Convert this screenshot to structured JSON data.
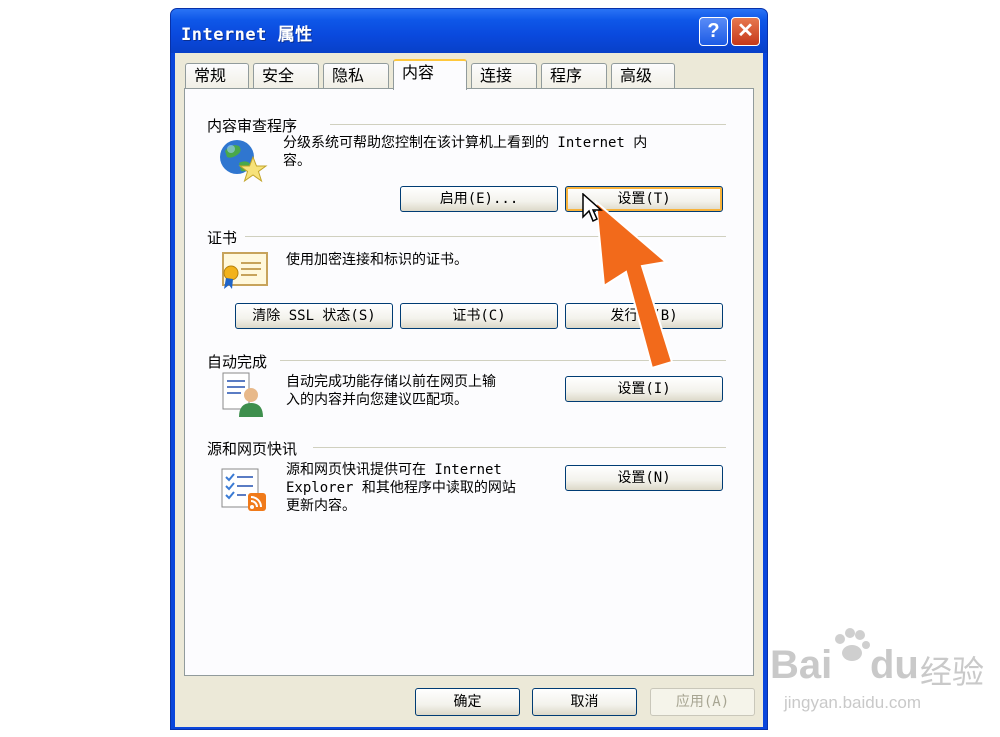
{
  "window": {
    "title": "Internet 属性",
    "help_symbol": "?",
    "close_symbol": "✕"
  },
  "tabs": [
    {
      "label": "常规"
    },
    {
      "label": "安全"
    },
    {
      "label": "隐私"
    },
    {
      "label": "内容"
    },
    {
      "label": "连接"
    },
    {
      "label": "程序"
    },
    {
      "label": "高级"
    }
  ],
  "active_tab": "内容",
  "content_advisor": {
    "title": "内容审查程序",
    "desc_line1": "分级系统可帮助您控制在该计算机上看到的 Internet 内",
    "desc_line2": "容。",
    "enable_label": "启用(E)...",
    "settings_label": "设置(T)"
  },
  "certificates": {
    "title": "证书",
    "desc": "使用加密连接和标识的证书。",
    "clear_ssl_label": "清除 SSL 状态(S)",
    "certs_label": "证书(C)",
    "publishers_label": "发行者(B)"
  },
  "autocomplete": {
    "title": "自动完成",
    "desc_line1": "自动完成功能存储以前在网页上输",
    "desc_line2": "入的内容并向您建议匹配项。",
    "settings_label": "设置(I)"
  },
  "feeds": {
    "title": "源和网页快讯",
    "desc_line1": "源和网页快讯提供可在 Internet",
    "desc_line2": "Explorer 和其他程序中读取的网站",
    "desc_line3": "更新内容。",
    "settings_label": "设置(N)"
  },
  "footer": {
    "ok_label": "确定",
    "cancel_label": "取消",
    "apply_label": "应用(A)"
  },
  "annotation": {
    "arrow_color": "#f26a1b"
  },
  "watermark": {
    "brand": "Bai",
    "brand2": "du",
    "cn": "经验",
    "url": "jingyan.baidu.com"
  }
}
